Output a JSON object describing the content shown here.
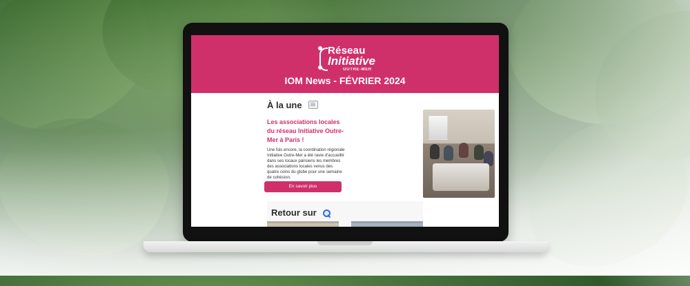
{
  "email": {
    "brand": {
      "logo_line1": "Réseau",
      "logo_line2": "Initiative",
      "logo_line3": "OUTRE-MER"
    },
    "title": "IOM News - FÉVRIER 2024",
    "sections": {
      "a_la_une": {
        "title": "À la une",
        "icon": "newspaper-icon",
        "headline": "Les associations locales du réseau Initiative Outre-Mer à Paris !",
        "body": "Une fois encore, la coordination régionale Initiative Outre-Mer a été ravie d'accueillir dans ses locaux parisiens les membres des associations locales venus des quatre coins du globe pour une semaine de cohésion.",
        "cta_label": "En savoir plus",
        "image": "meeting-photo"
      },
      "retour_sur": {
        "title": "Retour sur",
        "icon": "magnifier-icon",
        "thumbnails": [
          "thumbnail-1",
          "thumbnail-2"
        ]
      }
    },
    "colors": {
      "brand_pink": "#d0306a",
      "laptop_frame": "#111111"
    }
  }
}
